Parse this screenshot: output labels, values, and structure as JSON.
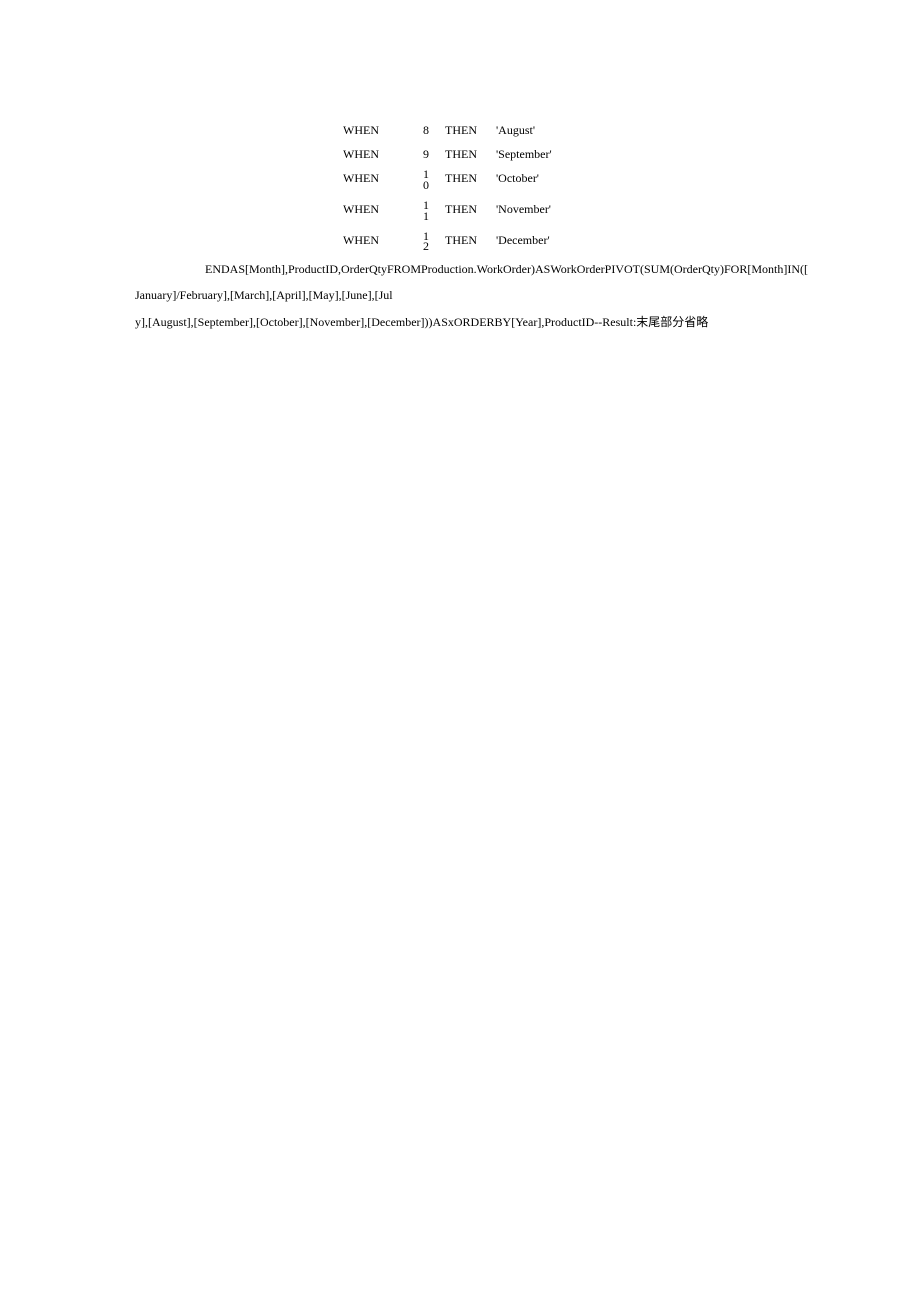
{
  "table": {
    "rows": [
      {
        "when": "WHEN",
        "num": "8",
        "then": "THEN",
        "val": "'August'"
      },
      {
        "when": "WHEN",
        "num": "9",
        "then": "THEN",
        "val": "'September'"
      },
      {
        "when": "WHEN",
        "num": "10",
        "then": "THEN",
        "val": "'October'"
      },
      {
        "when": "WHEN",
        "num": "11",
        "then": "THEN",
        "val": "'November'"
      },
      {
        "when": "WHEN",
        "num": "12",
        "then": "THEN",
        "val": "'December'"
      }
    ]
  },
  "body": {
    "line1": "ENDAS[Month],ProductID,OrderQtyFROMProduction.WorkOrder)ASWorkOrderPIVOT(SUM(OrderQty)FOR[Month]IN([",
    "line2": "January]/February],[March],[April],[May],[June],[Jul",
    "line3": "y],[August],[September],[October],[November],[December]))ASxORDERBY[Year],ProductID--Result:末尾部分省略"
  }
}
